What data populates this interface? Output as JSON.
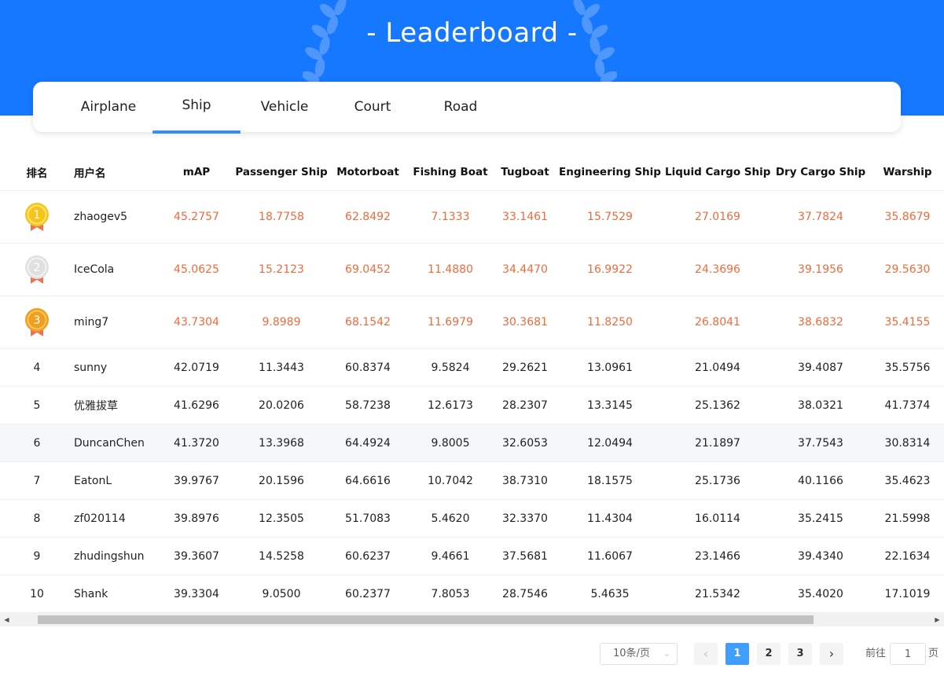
{
  "header": {
    "title": "- Leaderboard -"
  },
  "tabs": [
    {
      "label": "Airplane",
      "active": false
    },
    {
      "label": "Ship",
      "active": true
    },
    {
      "label": "Vehicle",
      "active": false
    },
    {
      "label": "Court",
      "active": false
    },
    {
      "label": "Road",
      "active": false
    }
  ],
  "table": {
    "columns": [
      "排名",
      "用户名",
      "mAP",
      "Passenger Ship",
      "Motorboat",
      "Fishing Boat",
      "Tugboat",
      "Engineering Ship",
      "Liquid Cargo Ship",
      "Dry Cargo Ship",
      "Warship"
    ],
    "rows": [
      {
        "rank": "1",
        "user": "zhaogev5",
        "values": [
          "45.2757",
          "18.7758",
          "62.8492",
          "7.1333",
          "33.1461",
          "15.7529",
          "27.0169",
          "37.7824",
          "35.8679"
        ]
      },
      {
        "rank": "2",
        "user": "IceCola",
        "values": [
          "45.0625",
          "15.2123",
          "69.0452",
          "11.4880",
          "34.4470",
          "16.9922",
          "24.3696",
          "39.1956",
          "29.5630"
        ]
      },
      {
        "rank": "3",
        "user": "ming7",
        "values": [
          "43.7304",
          "9.8989",
          "68.1542",
          "11.6979",
          "30.3681",
          "11.8250",
          "26.8041",
          "38.6832",
          "35.4155"
        ]
      },
      {
        "rank": "4",
        "user": "sunny",
        "values": [
          "42.0719",
          "11.3443",
          "60.8374",
          "9.5824",
          "29.2621",
          "13.0961",
          "21.0494",
          "39.4087",
          "35.5756"
        ]
      },
      {
        "rank": "5",
        "user": "优雅拔草",
        "values": [
          "41.6296",
          "20.0206",
          "58.7238",
          "12.6173",
          "28.2307",
          "13.3145",
          "25.1362",
          "38.0321",
          "41.7374"
        ]
      },
      {
        "rank": "6",
        "user": "DuncanChen",
        "values": [
          "41.3720",
          "13.3968",
          "64.4924",
          "9.8005",
          "32.6053",
          "12.0494",
          "21.1897",
          "37.7543",
          "30.8314"
        ]
      },
      {
        "rank": "7",
        "user": "EatonL",
        "values": [
          "39.9767",
          "20.1596",
          "64.6616",
          "10.7042",
          "38.7310",
          "18.1575",
          "25.1736",
          "40.1166",
          "35.4623"
        ]
      },
      {
        "rank": "8",
        "user": "zf020114",
        "values": [
          "39.8976",
          "12.3505",
          "51.7083",
          "5.4620",
          "32.3370",
          "11.4304",
          "16.0114",
          "35.2415",
          "21.5998"
        ]
      },
      {
        "rank": "9",
        "user": "zhudingshun",
        "values": [
          "39.3607",
          "14.5258",
          "60.6237",
          "9.4661",
          "37.5681",
          "11.6067",
          "23.1466",
          "39.4340",
          "22.1634"
        ]
      },
      {
        "rank": "10",
        "user": "Shank",
        "values": [
          "39.3304",
          "9.0500",
          "60.2377",
          "7.8053",
          "28.7546",
          "5.4635",
          "21.5342",
          "35.4020",
          "17.1019"
        ]
      }
    ]
  },
  "pagination": {
    "page_size_label": "10条/页",
    "pages": [
      "1",
      "2",
      "3"
    ],
    "current": "1",
    "goto_prefix": "前往",
    "goto_value": "1",
    "goto_suffix": "页"
  },
  "colors": {
    "header_bg": "#1677ff",
    "top3_text": "#ef6b3c",
    "gold": "#f5c518",
    "silver": "#e0e0e0",
    "bronze": "#f0a020",
    "ribbon": "#f0714f",
    "active_page": "#409eff",
    "tab_indicator": "#3a8ee6"
  },
  "icons": {
    "medal_1": "gold-medal-icon",
    "medal_2": "silver-medal-icon",
    "medal_3": "bronze-medal-icon"
  }
}
